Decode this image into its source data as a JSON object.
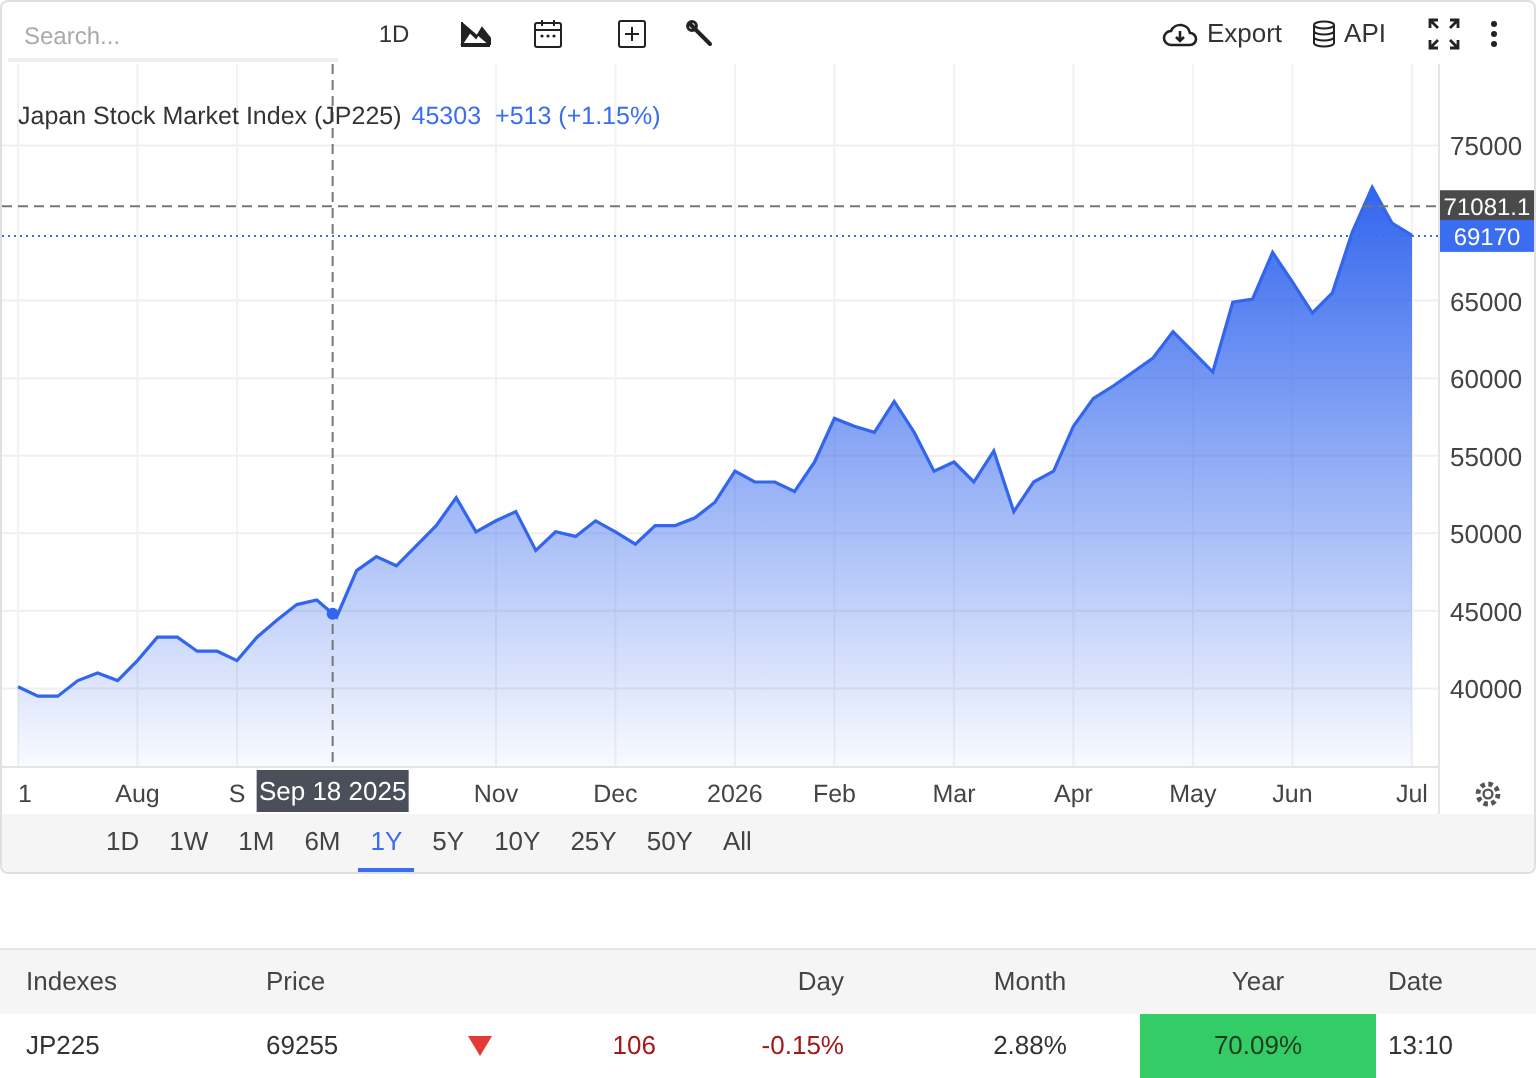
{
  "toolbar": {
    "search": {
      "placeholder": "Search..."
    },
    "interval": "1D",
    "export_label": "Export",
    "api_label": "API"
  },
  "chart": {
    "title": "Japan Stock Market Index (JP225)",
    "readout_price": "45303",
    "readout_change": "+513 (+1.15%)",
    "crosshair": {
      "date_label": "Sep 18 2025"
    },
    "chart_data": {
      "type": "area",
      "grid": true,
      "ref_lines": [
        {
          "axis": "y",
          "value": 71081.1,
          "label": "71081.1"
        },
        {
          "axis": "y",
          "value": 69170,
          "label": "69170"
        }
      ],
      "categories": [
        "1",
        null,
        null,
        null,
        null,
        null,
        "Aug",
        null,
        null,
        null,
        null,
        "S",
        null,
        null,
        null,
        null,
        null,
        null,
        null,
        null,
        null,
        null,
        null,
        null,
        "Nov",
        null,
        null,
        null,
        null,
        null,
        "Dec",
        null,
        null,
        null,
        null,
        null,
        "2026",
        null,
        null,
        null,
        null,
        "Feb",
        null,
        null,
        null,
        null,
        null,
        "Mar",
        null,
        null,
        null,
        null,
        null,
        "Apr",
        null,
        null,
        null,
        null,
        null,
        "May",
        null,
        null,
        null,
        null,
        "Jun",
        null,
        null,
        null,
        null,
        null,
        "Jul"
      ],
      "series": [
        {
          "color": "#3366ee",
          "values": [
            40100,
            39500,
            39500,
            40500,
            41000,
            40500,
            41800,
            43300,
            43300,
            42400,
            42400,
            41800,
            43300,
            44400,
            45400,
            45700,
            44600,
            47600,
            48500,
            47900,
            49200,
            50500,
            52300,
            50100,
            50800,
            51400,
            48900,
            50100,
            49800,
            50800,
            50100,
            49300,
            50500,
            50500,
            51000,
            52000,
            54000,
            53300,
            53300,
            52700,
            54600,
            57400,
            56900,
            56500,
            58500,
            56500,
            54000,
            54600,
            53300,
            55300,
            51400,
            53300,
            54000,
            56900,
            58700,
            59500,
            60400,
            61300,
            63000,
            61700,
            60400,
            64900,
            65100,
            68100,
            66200,
            64200,
            65500,
            69400,
            72300,
            70000,
            69200
          ]
        }
      ],
      "ylim": [
        35000,
        80250
      ],
      "yticks": [
        40000,
        45000,
        50000,
        55000,
        60000,
        65000,
        75000
      ]
    }
  },
  "ranges": [
    {
      "label": "1D",
      "selected": false
    },
    {
      "label": "1W",
      "selected": false
    },
    {
      "label": "1M",
      "selected": false
    },
    {
      "label": "6M",
      "selected": false
    },
    {
      "label": "1Y",
      "selected": true
    },
    {
      "label": "5Y",
      "selected": false
    },
    {
      "label": "10Y",
      "selected": false
    },
    {
      "label": "25Y",
      "selected": false
    },
    {
      "label": "50Y",
      "selected": false
    },
    {
      "label": "All",
      "selected": false
    }
  ],
  "table": {
    "columns": [
      "Indexes",
      "Price",
      "Day",
      "Month",
      "Year",
      "Date"
    ],
    "rows": [
      {
        "index": "JP225",
        "price": "69255",
        "falling": true,
        "change": "106",
        "day": "-0.15%",
        "month": "2.88%",
        "year": "70.09%",
        "year_highlight": true,
        "date": "13:10"
      }
    ]
  }
}
